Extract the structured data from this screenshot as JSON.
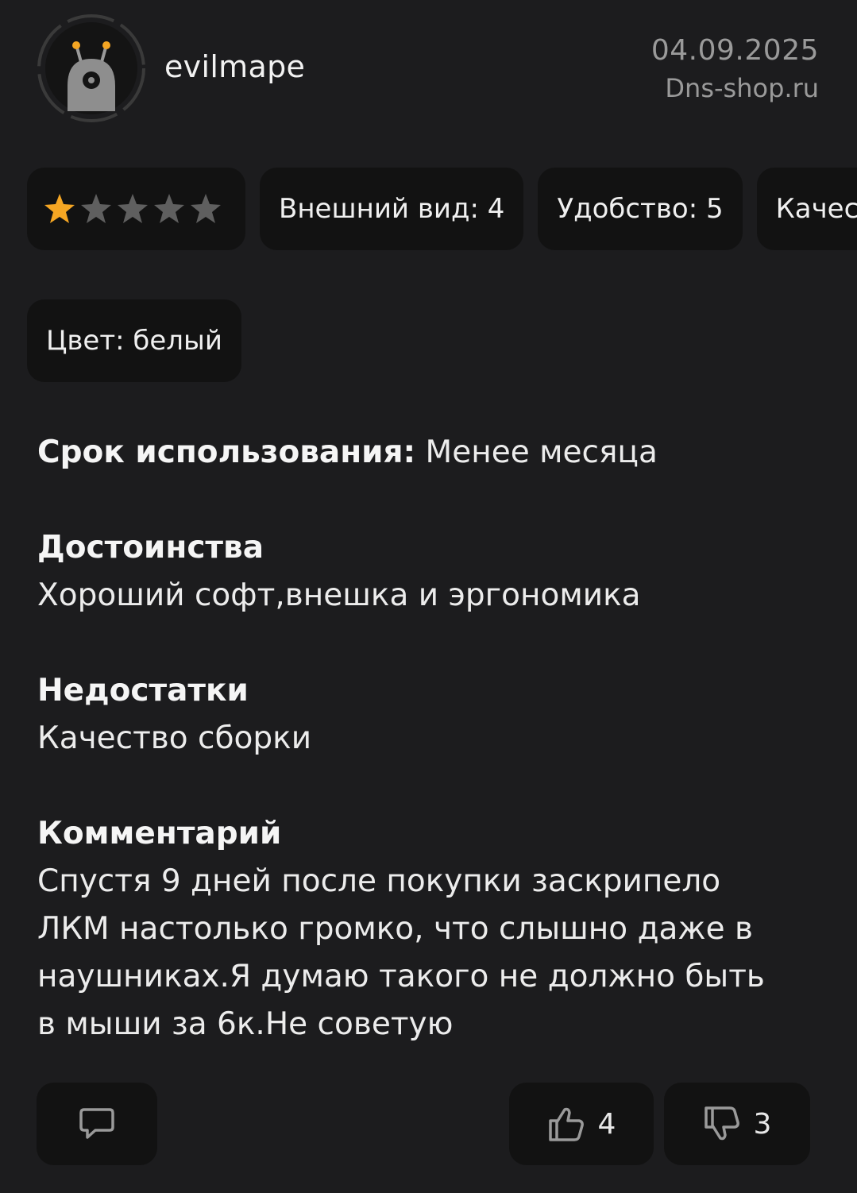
{
  "review": {
    "author": "evilmape",
    "date": "04.09.2025",
    "source": "Dns-shop.ru",
    "rating": 1,
    "rating_max": 5,
    "colors": {
      "star_active": "#f5a623",
      "star_inactive": "#5f5f5f",
      "background": "#1c1c1e",
      "chip": "#121212"
    }
  },
  "chips": [
    {
      "label": "Внешний вид: 4"
    },
    {
      "label": "Удобство: 5"
    },
    {
      "label": "Качество"
    }
  ],
  "color_chip": "Цвет: белый",
  "usage": {
    "label": "Срок использования:",
    "value": " Менее месяца"
  },
  "sections": {
    "pros": {
      "title": "Достоинства",
      "text": "Хороший софт,внешка и эргономика"
    },
    "cons": {
      "title": "Недостатки",
      "text": "Качество сборки"
    },
    "comment": {
      "title": "Комментарий",
      "text": "Спустя 9 дней после покупки  заскрипело ЛКМ настолько громко, что слышно даже в наушниках.Я думаю такого не должно быть в мыши за 6к.Не советую"
    }
  },
  "actions": {
    "comment_icon": "speech-bubble-icon",
    "likes": "4",
    "dislikes": "3"
  }
}
